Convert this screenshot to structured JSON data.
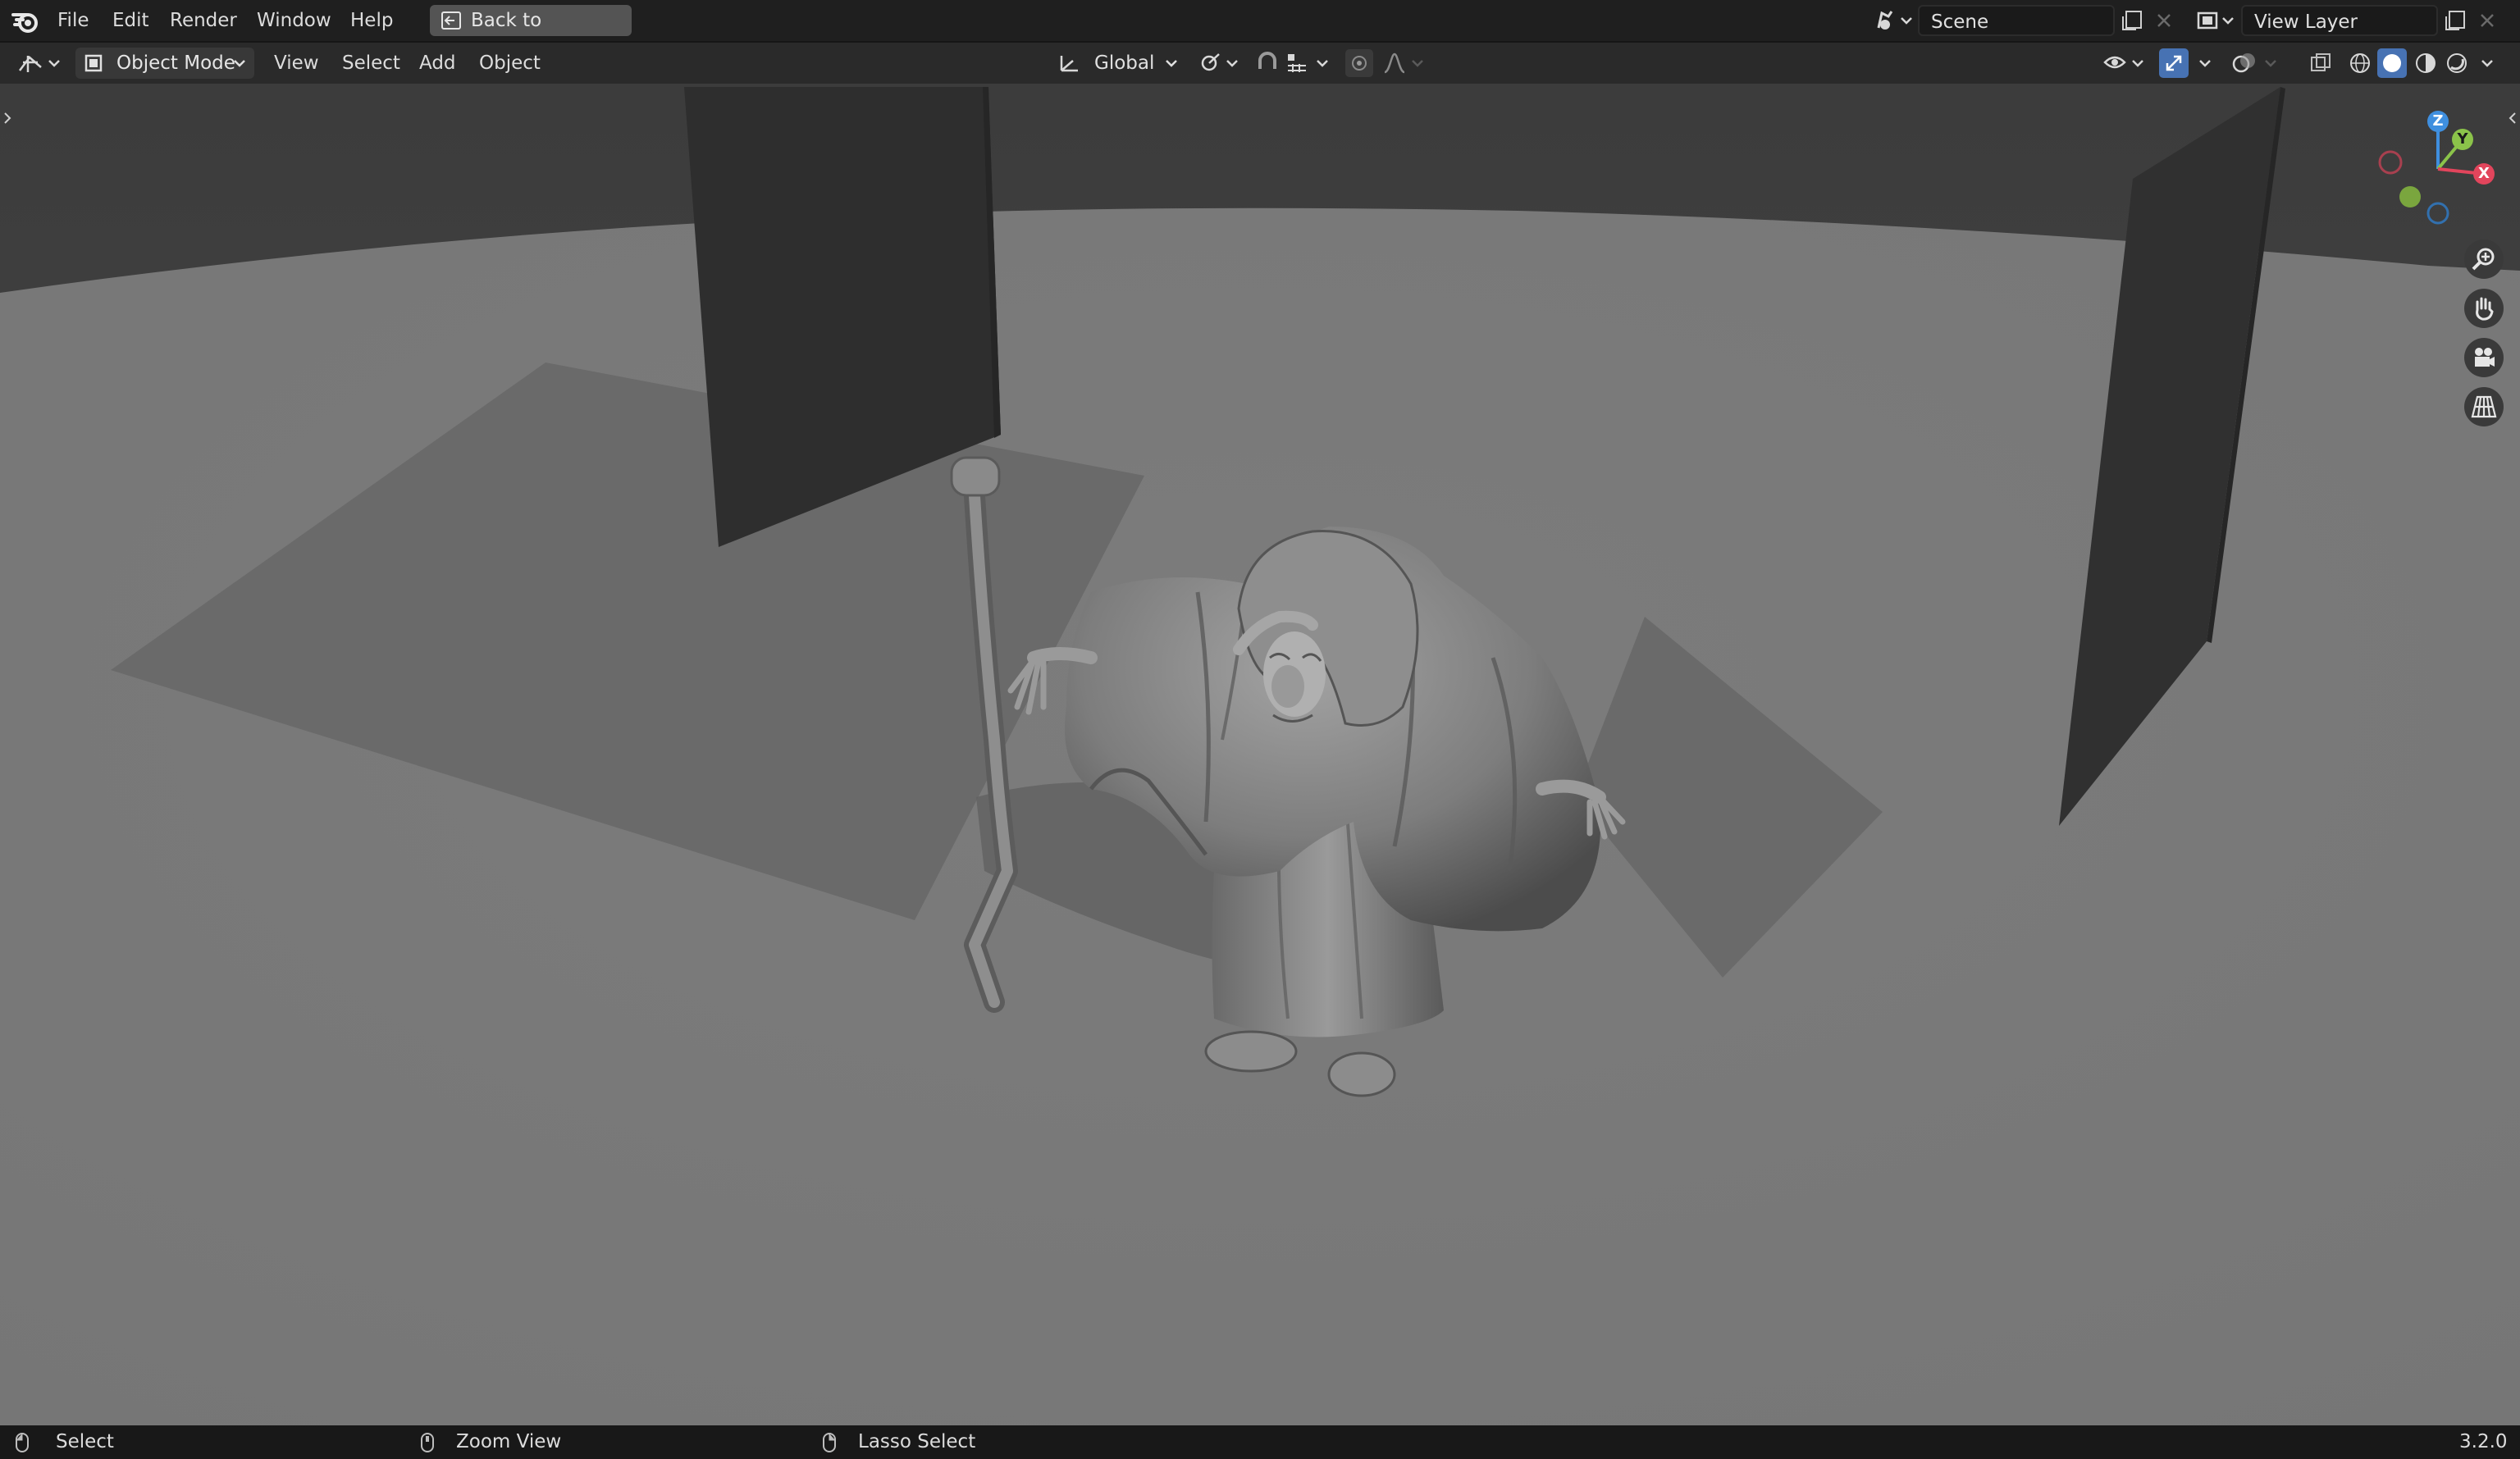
{
  "topbar": {
    "menus": [
      "File",
      "Edit",
      "Render",
      "Window",
      "Help"
    ],
    "back_button": "Back to Previous",
    "scene_name": "Scene",
    "view_layer_name": "View Layer"
  },
  "viewport_header": {
    "mode": "Object Mode",
    "menus": [
      "View",
      "Select",
      "Add",
      "Object"
    ],
    "transform_orientation": "Global"
  },
  "gizmo": {
    "axes": [
      "X",
      "Y",
      "Z"
    ],
    "colors": {
      "x": "#e2455c",
      "y": "#8bc34a",
      "z": "#3f8fdf"
    }
  },
  "navigation_tools": [
    "zoom-icon",
    "pan-hand-icon",
    "camera-icon",
    "grid-icon"
  ],
  "statusbar": {
    "left": "Select",
    "middle": "Zoom View",
    "right": "Lasso Select",
    "version": "3.2.0"
  },
  "colors": {
    "accent": "#4772b3",
    "ground": "#7a7a7a",
    "walls": "#2f2f2f"
  }
}
